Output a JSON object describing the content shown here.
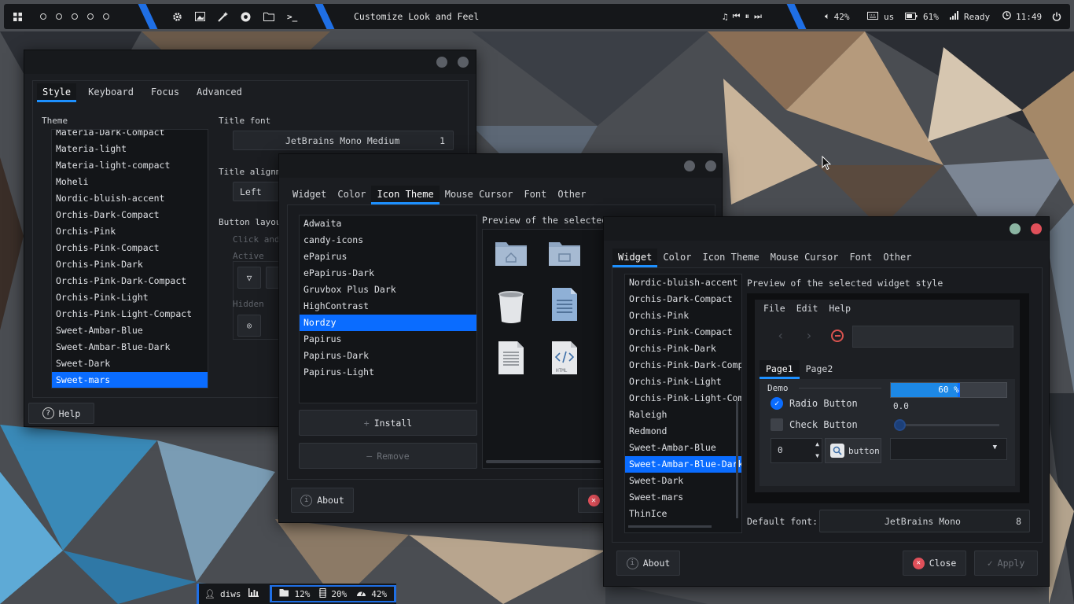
{
  "topbar": {
    "window_title": "Customize Look and Feel",
    "volume": "42%",
    "keyboard": "us",
    "battery": "61%",
    "network": "Ready",
    "clock": "11:49"
  },
  "win1": {
    "tabs": [
      "Style",
      "Keyboard",
      "Focus",
      "Advanced"
    ],
    "theme_label": "Theme",
    "themes": [
      "Materia-Dark-Compact",
      "Materia-light",
      "Materia-light-compact",
      "Moheli",
      "Nordic-bluish-accent",
      "Orchis-Dark-Compact",
      "Orchis-Pink",
      "Orchis-Pink-Compact",
      "Orchis-Pink-Dark",
      "Orchis-Pink-Dark-Compact",
      "Orchis-Pink-Light",
      "Orchis-Pink-Light-Compact",
      "Sweet-Ambar-Blue",
      "Sweet-Ambar-Blue-Dark",
      "Sweet-Dark",
      "Sweet-mars"
    ],
    "title_font_label": "Title font",
    "title_font_value": "JetBrains Mono Medium",
    "title_font_size": "1",
    "title_align_label": "Title alignme",
    "title_align_value": "Left",
    "button_layout_label": "Button layout",
    "click_and": "Click and",
    "active_label": "Active",
    "hidden_label": "Hidden",
    "help": "Help"
  },
  "win2": {
    "tabs": [
      "Widget",
      "Color",
      "Icon Theme",
      "Mouse Cursor",
      "Font",
      "Other"
    ],
    "icon_themes": [
      "Adwaita",
      "candy-icons",
      "ePapirus",
      "ePapirus-Dark",
      "Gruvbox Plus Dark",
      "HighContrast",
      "Nordzy",
      "Papirus",
      "Papirus-Dark",
      "Papirus-Light"
    ],
    "install": "Install",
    "remove": "Remove",
    "preview_label": "Preview of the selected ic",
    "html_label": "HTML",
    "about": "About"
  },
  "win3": {
    "tabs": [
      "Widget",
      "Color",
      "Icon Theme",
      "Mouse Cursor",
      "Font",
      "Other"
    ],
    "styles": [
      "Nordic-bluish-accent",
      "Orchis-Dark-Compact",
      "Orchis-Pink",
      "Orchis-Pink-Compact",
      "Orchis-Pink-Dark",
      "Orchis-Pink-Dark-Compa",
      "Orchis-Pink-Light",
      "Orchis-Pink-Light-Comp",
      "Raleigh",
      "Redmond",
      "Sweet-Ambar-Blue",
      "Sweet-Ambar-Blue-Dark",
      "Sweet-Dark",
      "Sweet-mars",
      "ThinIce"
    ],
    "preview_label": "Preview of the selected widget style",
    "menu": [
      "File",
      "Edit",
      "Help"
    ],
    "pages": [
      "Page1",
      "Page2"
    ],
    "demo": "Demo",
    "progress_text": "60 %",
    "progress_value": 0.6,
    "slider_value_text": "0.0",
    "radio": "Radio Button",
    "check": "Check Button",
    "spin_value": "0",
    "button": "button",
    "default_font_label": "Default font:",
    "default_font_value": "JetBrains Mono",
    "default_font_size": "8",
    "about": "About",
    "close": "Close",
    "apply": "Apply"
  },
  "dock": {
    "user": "diws",
    "disk": "12%",
    "memory": "20%",
    "cpu": "42%"
  },
  "colors": {
    "accent": "#0a6cff",
    "topbar_accent": "#1f6fe5",
    "close_red": "#e0505a",
    "max_green": "#8bb5a2"
  }
}
